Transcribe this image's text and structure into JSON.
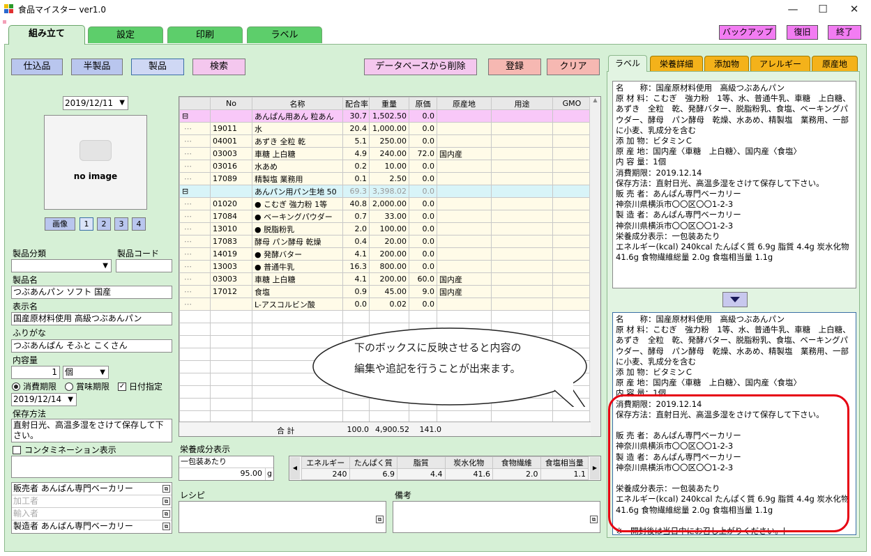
{
  "window": {
    "title": "食品マイスター ver1.0",
    "minimize": "—",
    "maximize": "☐",
    "close": "✕"
  },
  "tabs": [
    "組み立て",
    "設定",
    "印刷",
    "ラベル"
  ],
  "top_buttons": {
    "backup": "バックアップ",
    "restore": "復旧",
    "exit": "終了"
  },
  "toolbar": {
    "prep": "仕込品",
    "semi": "半製品",
    "product": "製品",
    "search": "検索",
    "delete": "データベースから削除",
    "register": "登録",
    "clear": "クリア"
  },
  "left": {
    "date": "2019/12/11",
    "no_image": "no image",
    "image_btn": "画像",
    "img_nums": [
      "1",
      "2",
      "3",
      "4"
    ],
    "category_label": "製品分類",
    "code_label": "製品コード",
    "name_label": "製品名",
    "name_value": "つぶあんパン ソフト 国産",
    "display_label": "表示名",
    "display_value": "国産原材料使用 高級つぶあんパン",
    "furigana_label": "ふりがな",
    "furigana_value": "つぶあんぱん そふと こくさん",
    "content_label": "内容量",
    "content_qty": "1",
    "content_unit": "個",
    "radio_consume": "消費期限",
    "radio_best": "賞味期限",
    "check_date": "日付指定",
    "expiry_date": "2019/12/14",
    "storage_label": "保存方法",
    "storage_value": "直射日光、高温多湿をさけて保存して下さい。",
    "contamination": "コンタミネーション表示",
    "seller": "販売者 あんぱん専門ベーカリー",
    "processor": "加工者",
    "importer": "輸入者",
    "maker": "製造者 あんぱん専門ベーカリー"
  },
  "grid": {
    "headers": [
      "No",
      "名称",
      "配合率",
      "重量",
      "原価",
      "原産地",
      "用途",
      "GMO"
    ],
    "rows": [
      {
        "kind": "group1",
        "exp": "⊟",
        "no": "",
        "name": "あんぱん用あん 粒あん",
        "ratio": "30.7",
        "weight": "1,502.50",
        "cost": "0.0",
        "origin": ""
      },
      {
        "kind": "child",
        "exp": "",
        "no": "19011",
        "name": "水",
        "ratio": "20.4",
        "weight": "1,000.00",
        "cost": "0.0",
        "origin": ""
      },
      {
        "kind": "child",
        "exp": "",
        "no": "04001",
        "name": "あずき 全粒 乾",
        "ratio": "5.1",
        "weight": "250.00",
        "cost": "0.0",
        "origin": ""
      },
      {
        "kind": "child",
        "exp": "",
        "no": "03003",
        "name": "車糖 上白糖",
        "ratio": "4.9",
        "weight": "240.00",
        "cost": "72.0",
        "origin": "国内産"
      },
      {
        "kind": "child",
        "exp": "",
        "no": "03016",
        "name": "水あめ",
        "ratio": "0.2",
        "weight": "10.00",
        "cost": "0.0",
        "origin": ""
      },
      {
        "kind": "child",
        "exp": "",
        "no": "17089",
        "name": "精製塩 業務用",
        "ratio": "0.1",
        "weight": "2.50",
        "cost": "0.0",
        "origin": ""
      },
      {
        "kind": "group2",
        "exp": "⊟",
        "no": "",
        "name": "あんパン用パン生地 50",
        "ratio": "69.3",
        "weight": "3,398.02",
        "cost": "0.0",
        "origin": ""
      },
      {
        "kind": "child",
        "exp": "",
        "no": "01020",
        "name": "● こむぎ 強力粉 1等",
        "ratio": "40.8",
        "weight": "2,000.00",
        "cost": "0.0",
        "origin": ""
      },
      {
        "kind": "child",
        "exp": "",
        "no": "17084",
        "name": "● ベーキングパウダー",
        "ratio": "0.7",
        "weight": "33.00",
        "cost": "0.0",
        "origin": ""
      },
      {
        "kind": "child",
        "exp": "",
        "no": "13010",
        "name": "● 脱脂粉乳",
        "ratio": "2.0",
        "weight": "100.00",
        "cost": "0.0",
        "origin": ""
      },
      {
        "kind": "child",
        "exp": "",
        "no": "17083",
        "name": "酵母 パン酵母 乾燥",
        "ratio": "0.4",
        "weight": "20.00",
        "cost": "0.0",
        "origin": ""
      },
      {
        "kind": "child",
        "exp": "",
        "no": "14019",
        "name": "● 発酵バター",
        "ratio": "4.1",
        "weight": "200.00",
        "cost": "0.0",
        "origin": ""
      },
      {
        "kind": "child",
        "exp": "",
        "no": "13003",
        "name": "● 普通牛乳",
        "ratio": "16.3",
        "weight": "800.00",
        "cost": "0.0",
        "origin": ""
      },
      {
        "kind": "child",
        "exp": "",
        "no": "03003",
        "name": "車糖 上白糖",
        "ratio": "4.1",
        "weight": "200.00",
        "cost": "60.0",
        "origin": "国内産"
      },
      {
        "kind": "child",
        "exp": "",
        "no": "17012",
        "name": "食塩",
        "ratio": "0.9",
        "weight": "45.00",
        "cost": "9.0",
        "origin": "国内産"
      },
      {
        "kind": "child",
        "exp": "",
        "no": "",
        "name": "L-アスコルビン酸",
        "ratio": "0.0",
        "weight": "0.02",
        "cost": "0.0",
        "origin": ""
      }
    ],
    "total_label": "合 計",
    "total_ratio": "100.0",
    "total_weight": "4,900.52",
    "total_cost": "141.0"
  },
  "nutrition": {
    "label": "栄養成分表示",
    "basis": "一包装あたり",
    "grams": "95.00",
    "unit": "g",
    "headers": [
      "エネルギー",
      "たんぱく質",
      "脂質",
      "炭水化物",
      "食物繊維",
      "食塩相当量"
    ],
    "values": [
      "240",
      "6.9",
      "4.4",
      "41.6",
      "2.0",
      "1.1"
    ]
  },
  "recipe_label": "レシピ",
  "notes_label": "備考",
  "right_tabs": [
    "ラベル",
    "栄養詳細",
    "添加物",
    "アレルギー",
    "原産地"
  ],
  "label_preview": "名　　称：国産原材料使用　高級つぶあんパン\n原 材 料：こむぎ　強力粉　1等、水、普通牛乳、車糖　上白糖、あずき　全粒　乾、発酵バター、脱脂粉乳、食塩、ベーキングパウダー、酵母　パン酵母　乾燥、水あめ、精製塩　業務用、一部に小麦、乳成分を含む\n添 加 物：ビタミンＣ\n原 産 地：国内産〈車糖　上白糖〉、国内産〈食塩〉\n内 容 量：1個\n消費期限：2019.12.14\n保存方法：直射日光、高温多湿をさけて保存して下さい。\n販 売 者：あんぱん専門ベーカリー\n神奈川県横浜市〇〇区〇〇1-2-3\n製 造 者：あんぱん専門ベーカリー\n神奈川県横浜市〇〇区〇〇1-2-3\n栄養成分表示：一包装あたり\nエネルギー(kcal) 240kcal たんぱく質 6.9g 脂質 4.4g 炭水化物 41.6g 食物繊維総量 2.0g 食塩相当量 1.1g",
  "label_edit": "名　　称：国産原材料使用　高級つぶあんパン\n原 材 料：こむぎ　強力粉　1等、水、普通牛乳、車糖　上白糖、あずき　全粒　乾、発酵バター、脱脂粉乳、食塩、ベーキングパウダー、酵母　パン酵母　乾燥、水あめ、精製塩　業務用、一部に小麦、乳成分を含む\n添 加 物：ビタミンＣ\n原 産 地：国内産〈車糖　上白糖〉、国内産〈食塩〉\n内 容 量：1個\n消費期限：2019.12.14\n保存方法：直射日光、高温多湿をさけて保存して下さい。\n\n販 売 者：あんぱん専門ベーカリー\n神奈川県横浜市〇〇区〇〇1-2-3\n製 造 者：あんぱん専門ベーカリー\n神奈川県横浜市〇〇区〇〇1-2-3\n\n栄養成分表示：一包装あたり\nエネルギー(kcal) 240kcal たんぱく質 6.9g 脂質 4.4g 炭水化物 41.6g 食物繊維総量 2.0g 食塩相当量 1.1g\n\n※　開封後は当日中にお召し上がりください。|",
  "callout": {
    "line1": "下のボックスに反映させると内容の",
    "line2": "編集や追記を行うことが出来ます。"
  },
  "colors": {
    "panel": "#d6f0d6",
    "tab": "#5dce6b",
    "magenta": "#f27cf2",
    "orange_tab": "#f4b21a",
    "callout_red": "#e60012",
    "group1_row": "#f8c8f8",
    "group2_row": "#d8f4f8",
    "child_row": "#fffbe8"
  }
}
